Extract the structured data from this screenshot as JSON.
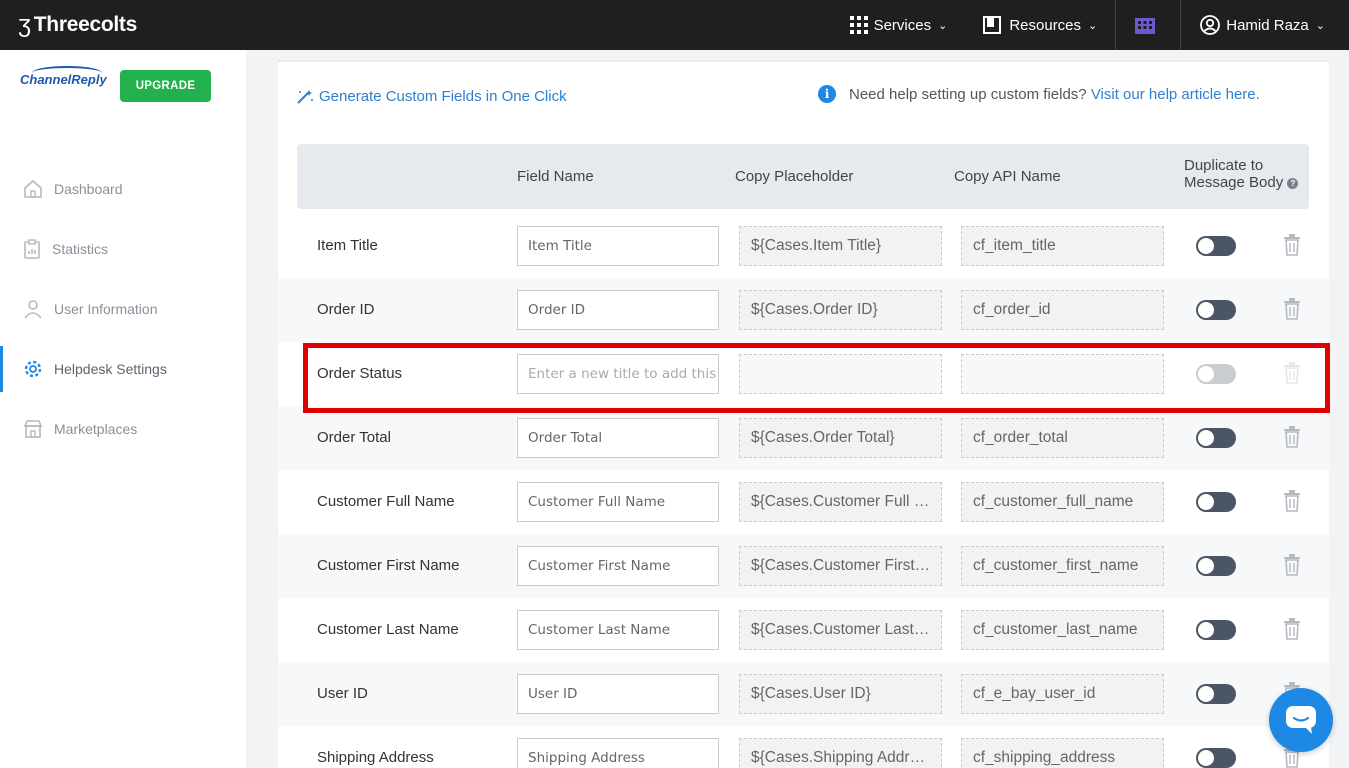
{
  "topbar": {
    "brand": "Threecolts",
    "services_label": "Services",
    "resources_label": "Resources",
    "user_name": "Hamid Raza"
  },
  "sidebar": {
    "logo_text_channel": "Channel",
    "logo_text_reply": "Reply",
    "upgrade_label": "UPGRADE",
    "items": [
      {
        "label": "Dashboard",
        "icon": "home-icon"
      },
      {
        "label": "Statistics",
        "icon": "clipboard-icon"
      },
      {
        "label": "User Information",
        "icon": "user-icon"
      },
      {
        "label": "Helpdesk Settings",
        "icon": "gear-icon",
        "active": true
      },
      {
        "label": "Marketplaces",
        "icon": "store-icon"
      }
    ]
  },
  "main": {
    "generate_link": "Generate Custom Fields in One Click",
    "help_text": "Need help setting up custom fields?",
    "help_link": "Visit our help article here.",
    "columns": {
      "field_name": "Field Name",
      "copy_placeholder": "Copy Placeholder",
      "copy_api_name": "Copy API Name",
      "duplicate": "Duplicate to Message Body"
    },
    "rows": [
      {
        "label": "Item Title",
        "field": "Item Title",
        "placeholder": "${Cases.Item Title}",
        "api": "cf_item_title"
      },
      {
        "label": "Order ID",
        "field": "Order ID",
        "placeholder": "${Cases.Order ID}",
        "api": "cf_order_id"
      },
      {
        "label": "Order Status",
        "field_placeholder": "Enter a new title to add this field",
        "placeholder": "",
        "api": "",
        "disabled": true
      },
      {
        "label": "Order Total",
        "field": "Order Total",
        "placeholder": "${Cases.Order Total}",
        "api": "cf_order_total"
      },
      {
        "label": "Customer Full Name",
        "field": "Customer Full Name",
        "placeholder": "${Cases.Customer Full Name}",
        "api": "cf_customer_full_name"
      },
      {
        "label": "Customer First Name",
        "field": "Customer First Name",
        "placeholder": "${Cases.Customer First Name}",
        "api": "cf_customer_first_name"
      },
      {
        "label": "Customer Last Name",
        "field": "Customer Last Name",
        "placeholder": "${Cases.Customer Last Name}",
        "api": "cf_customer_last_name"
      },
      {
        "label": "User ID",
        "field": "User ID",
        "placeholder": "${Cases.User ID}",
        "api": "cf_e_bay_user_id"
      },
      {
        "label": "Shipping Address",
        "field": "Shipping Address",
        "placeholder": "${Cases.Shipping Address}",
        "api": "cf_shipping_address"
      }
    ]
  },
  "colors": {
    "accent": "#1e88e5",
    "upgrade": "#22b14c",
    "highlight": "#e00000",
    "topbar": "#1f1f1f"
  }
}
